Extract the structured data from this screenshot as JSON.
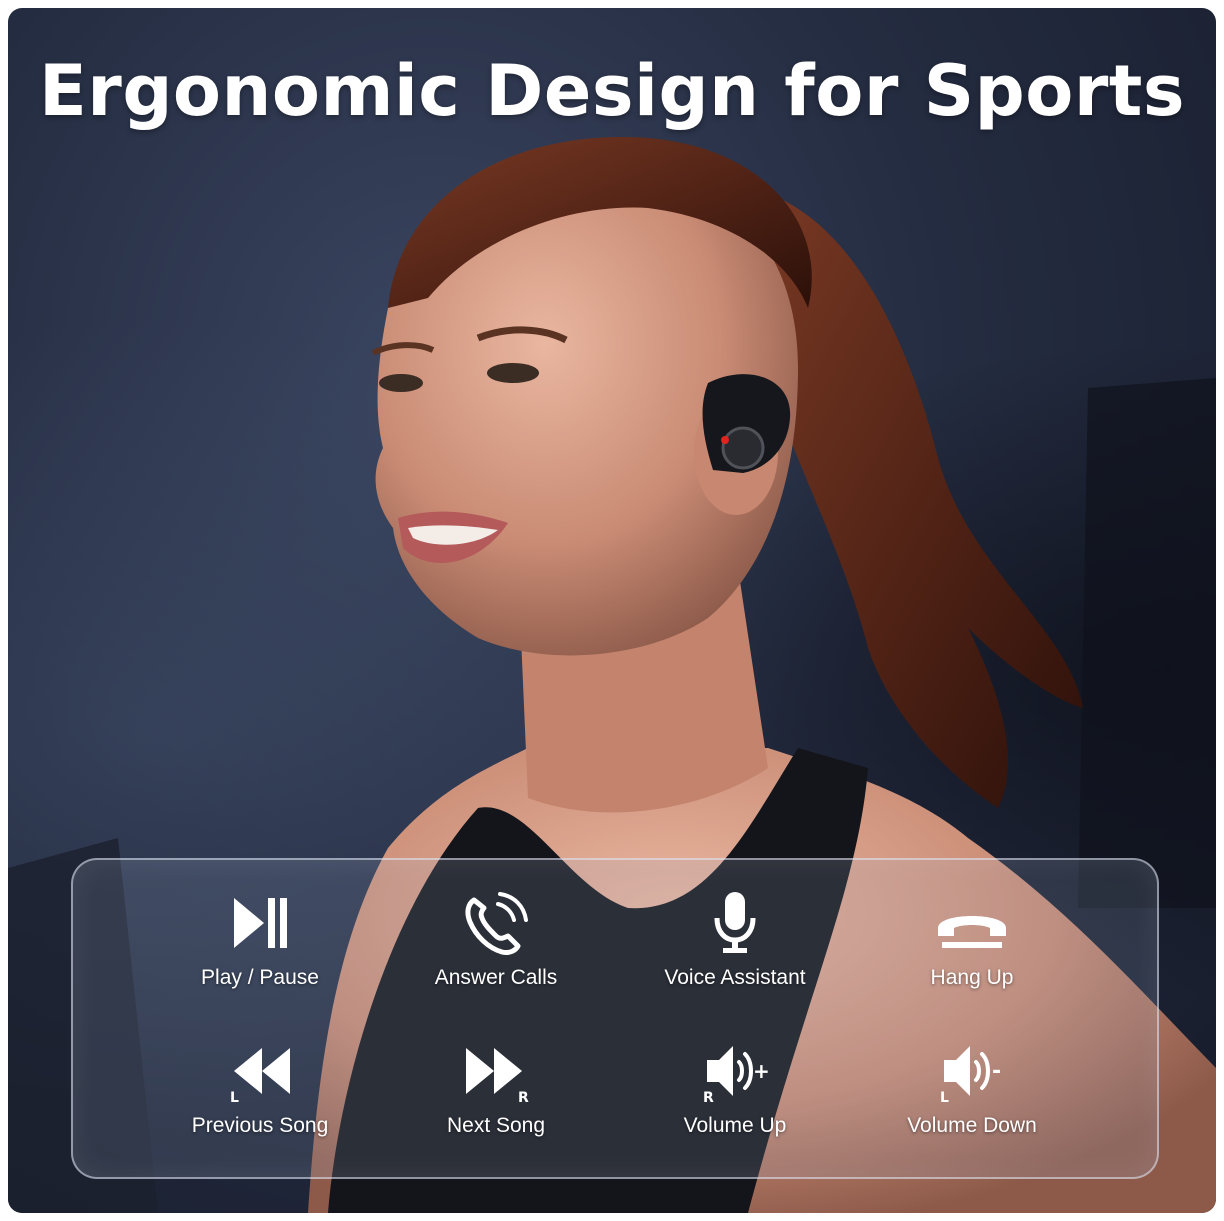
{
  "title": "Ergonomic Design for Sports",
  "controls": [
    {
      "label": "Play / Pause",
      "icon": "play-pause-icon"
    },
    {
      "label": "Answer Calls",
      "icon": "phone-ringing-icon"
    },
    {
      "label": "Voice Assistant",
      "icon": "microphone-icon"
    },
    {
      "label": "Hang Up",
      "icon": "hang-up-icon"
    },
    {
      "label": "Previous Song",
      "icon": "rewind-icon",
      "side": "L"
    },
    {
      "label": "Next Song",
      "icon": "fast-forward-icon",
      "side": "R"
    },
    {
      "label": "Volume Up",
      "icon": "volume-up-icon",
      "side": "R",
      "sign": "+"
    },
    {
      "label": "Volume Down",
      "icon": "volume-down-icon",
      "side": "L",
      "sign": "-"
    }
  ],
  "colors": {
    "background": "#1f2638",
    "text": "#ffffff",
    "earbud_led": "#e0241b"
  }
}
